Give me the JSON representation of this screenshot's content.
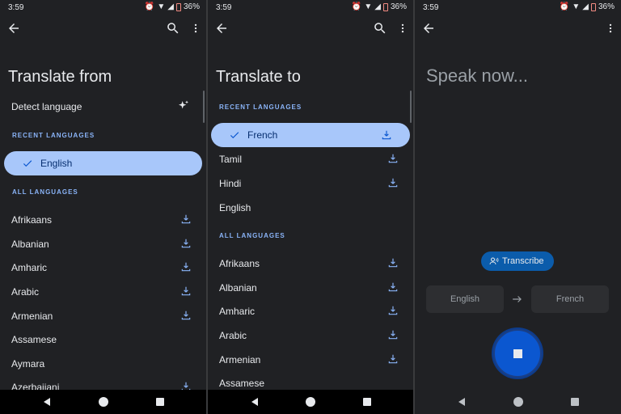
{
  "status": {
    "time": "3:59",
    "battery": "36%"
  },
  "panel1": {
    "title": "Translate from",
    "detect_label": "Detect language",
    "recent_header": "RECENT LANGUAGES",
    "selected": "English",
    "all_header": "ALL LANGUAGES",
    "languages": [
      "Afrikaans",
      "Albanian",
      "Amharic",
      "Arabic",
      "Armenian",
      "Assamese",
      "Aymara",
      "Azerbaijani"
    ]
  },
  "panel2": {
    "title": "Translate to",
    "recent_header": "RECENT LANGUAGES",
    "selected": "French",
    "recent": [
      "Tamil",
      "Hindi",
      "English"
    ],
    "all_header": "ALL LANGUAGES",
    "languages": [
      "Afrikaans",
      "Albanian",
      "Amharic",
      "Arabic",
      "Armenian",
      "Assamese"
    ]
  },
  "panel3": {
    "prompt": "Speak now...",
    "transcribe_label": "Transcribe",
    "source_lang": "English",
    "target_lang": "French"
  },
  "colors": {
    "accent": "#8ab4f8",
    "pill": "#a8c7fa",
    "mic": "#0b57d0",
    "background": "#202124"
  },
  "icons": [
    "back-arrow-icon",
    "search-icon",
    "more-vert-icon",
    "sparkle-icon",
    "check-icon",
    "download-icon",
    "transcribe-icon",
    "arrow-right-icon",
    "stop-icon"
  ]
}
